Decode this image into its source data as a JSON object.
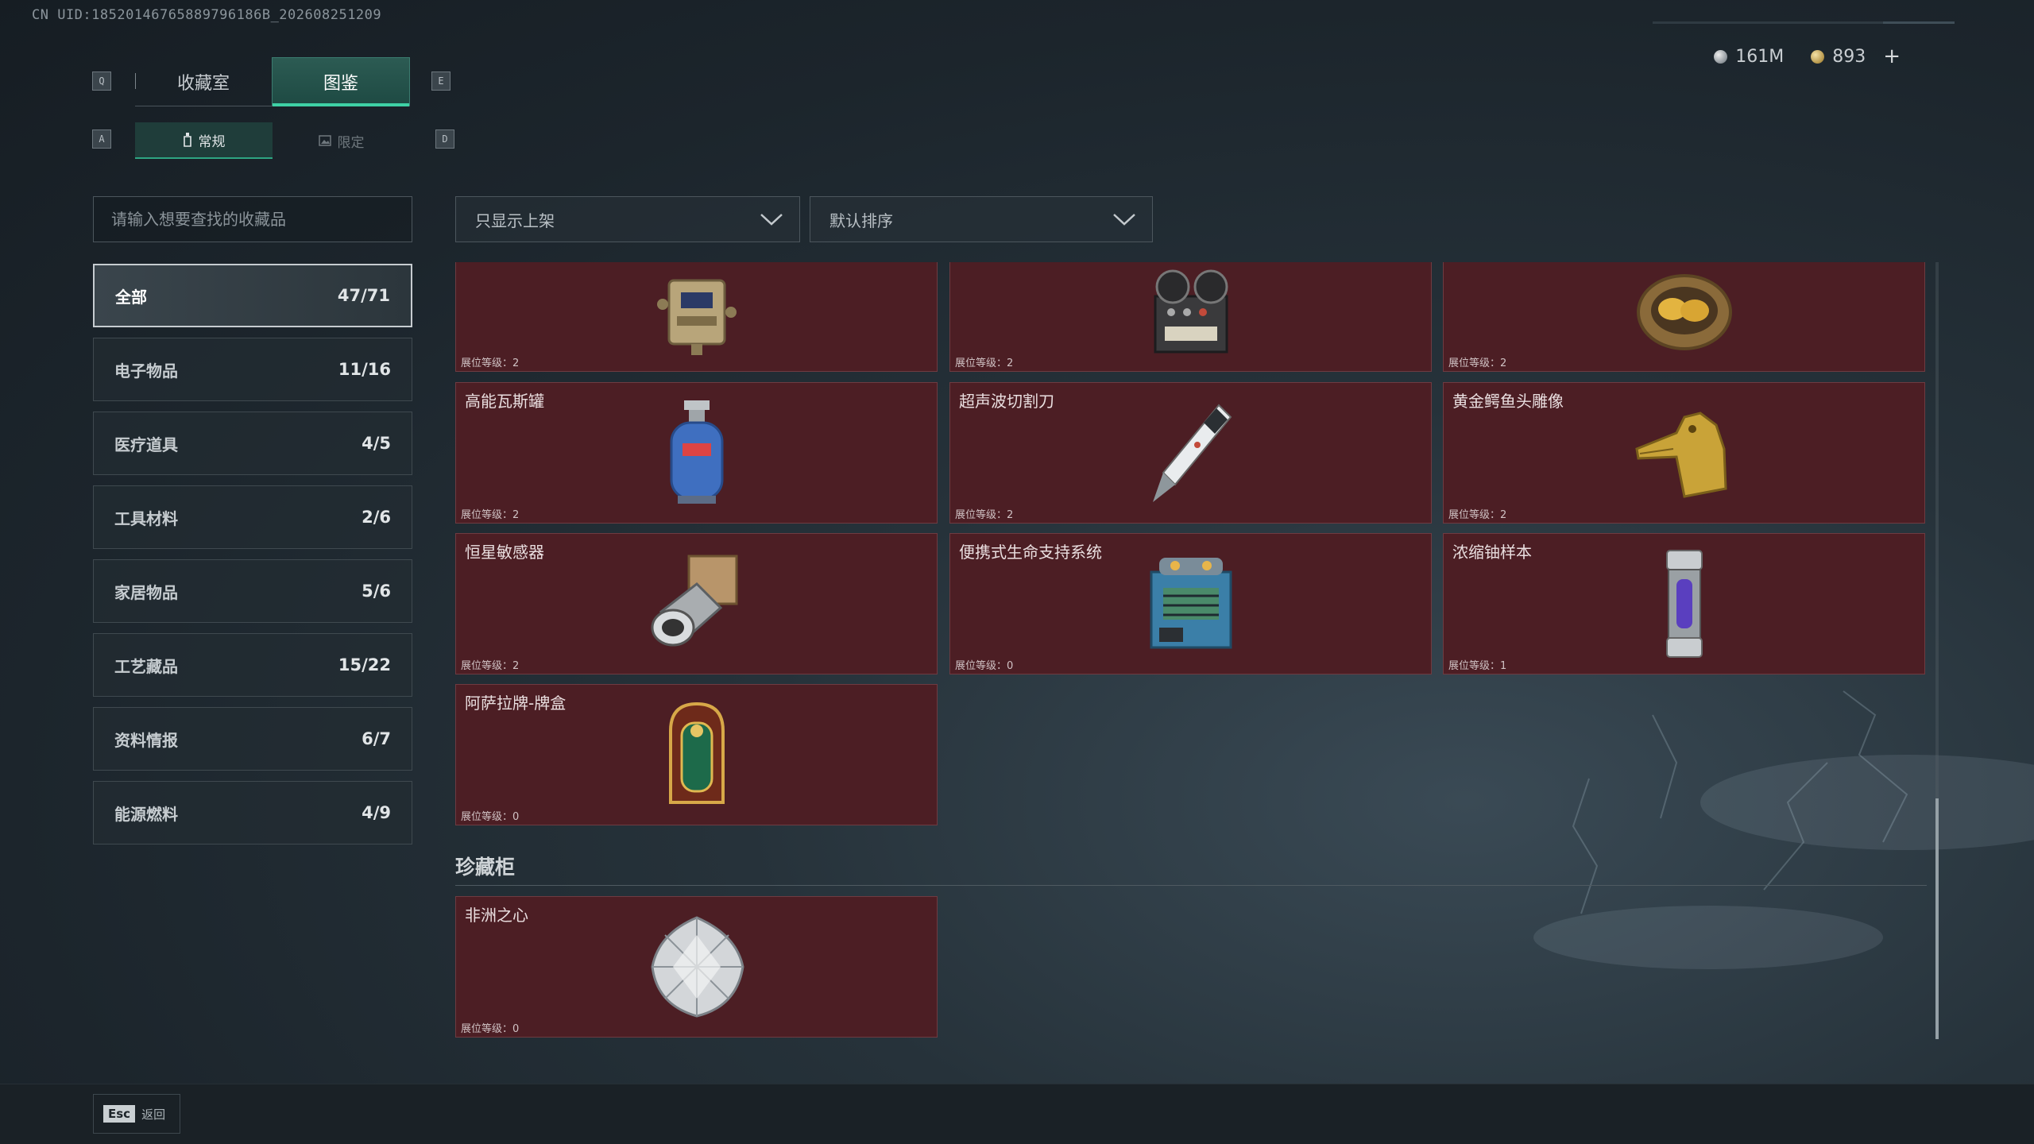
{
  "uid": "CN UID:18520146765889796186B_202608251209",
  "currency": {
    "silver": "161M",
    "gold": "893",
    "add": "+"
  },
  "keys": {
    "q": "Q",
    "e": "E",
    "a": "A",
    "d": "D"
  },
  "tabs": [
    {
      "label": "收藏室"
    },
    {
      "label": "图鉴"
    }
  ],
  "subtabs": [
    {
      "label": "常规"
    },
    {
      "label": "限定"
    }
  ],
  "search": {
    "placeholder": "请输入想要查找的收藏品"
  },
  "filters": {
    "shelf": "只显示上架",
    "sort": "默认排序"
  },
  "categories": [
    {
      "label": "全部",
      "count": "47/71"
    },
    {
      "label": "电子物品",
      "count": "11/16"
    },
    {
      "label": "医疗道具",
      "count": "4/5"
    },
    {
      "label": "工具材料",
      "count": "2/6"
    },
    {
      "label": "家居物品",
      "count": "5/6"
    },
    {
      "label": "工艺藏品",
      "count": "15/22"
    },
    {
      "label": "资料情报",
      "count": "6/7"
    },
    {
      "label": "能源燃料",
      "count": "4/9"
    }
  ],
  "items": [
    {
      "name": "",
      "level": "展位等级：2",
      "icon": "electronic-device-icon"
    },
    {
      "name": "",
      "level": "展位等级：2",
      "icon": "tape-recorder-icon"
    },
    {
      "name": "",
      "level": "展位等级：2",
      "icon": "golden-egg-nest-icon"
    },
    {
      "name": "高能瓦斯罐",
      "level": "展位等级：2",
      "icon": "gas-canister-icon"
    },
    {
      "name": "超声波切割刀",
      "level": "展位等级：2",
      "icon": "ultrasonic-cutter-icon"
    },
    {
      "name": "黄金鳄鱼头雕像",
      "level": "展位等级：2",
      "icon": "gold-crocodile-icon"
    },
    {
      "name": "恒星敏感器",
      "level": "展位等级：2",
      "icon": "star-sensor-icon"
    },
    {
      "name": "便携式生命支持系统",
      "level": "展位等级：0",
      "icon": "life-support-icon"
    },
    {
      "name": "浓缩铀样本",
      "level": "展位等级：1",
      "icon": "uranium-sample-icon"
    },
    {
      "name": "阿萨拉牌-牌盒",
      "level": "展位等级：0",
      "icon": "card-box-icon"
    }
  ],
  "treasure": {
    "title": "珍藏柜",
    "items": [
      {
        "name": "非洲之心",
        "level": "展位等级：0",
        "icon": "diamond-icon"
      }
    ]
  },
  "footer": {
    "esc_key": "Esc",
    "esc_label": "返回"
  },
  "colors": {
    "accent": "#3ed1a5",
    "card_bg": "#4c1e24",
    "card_border": "#6e3b41"
  }
}
